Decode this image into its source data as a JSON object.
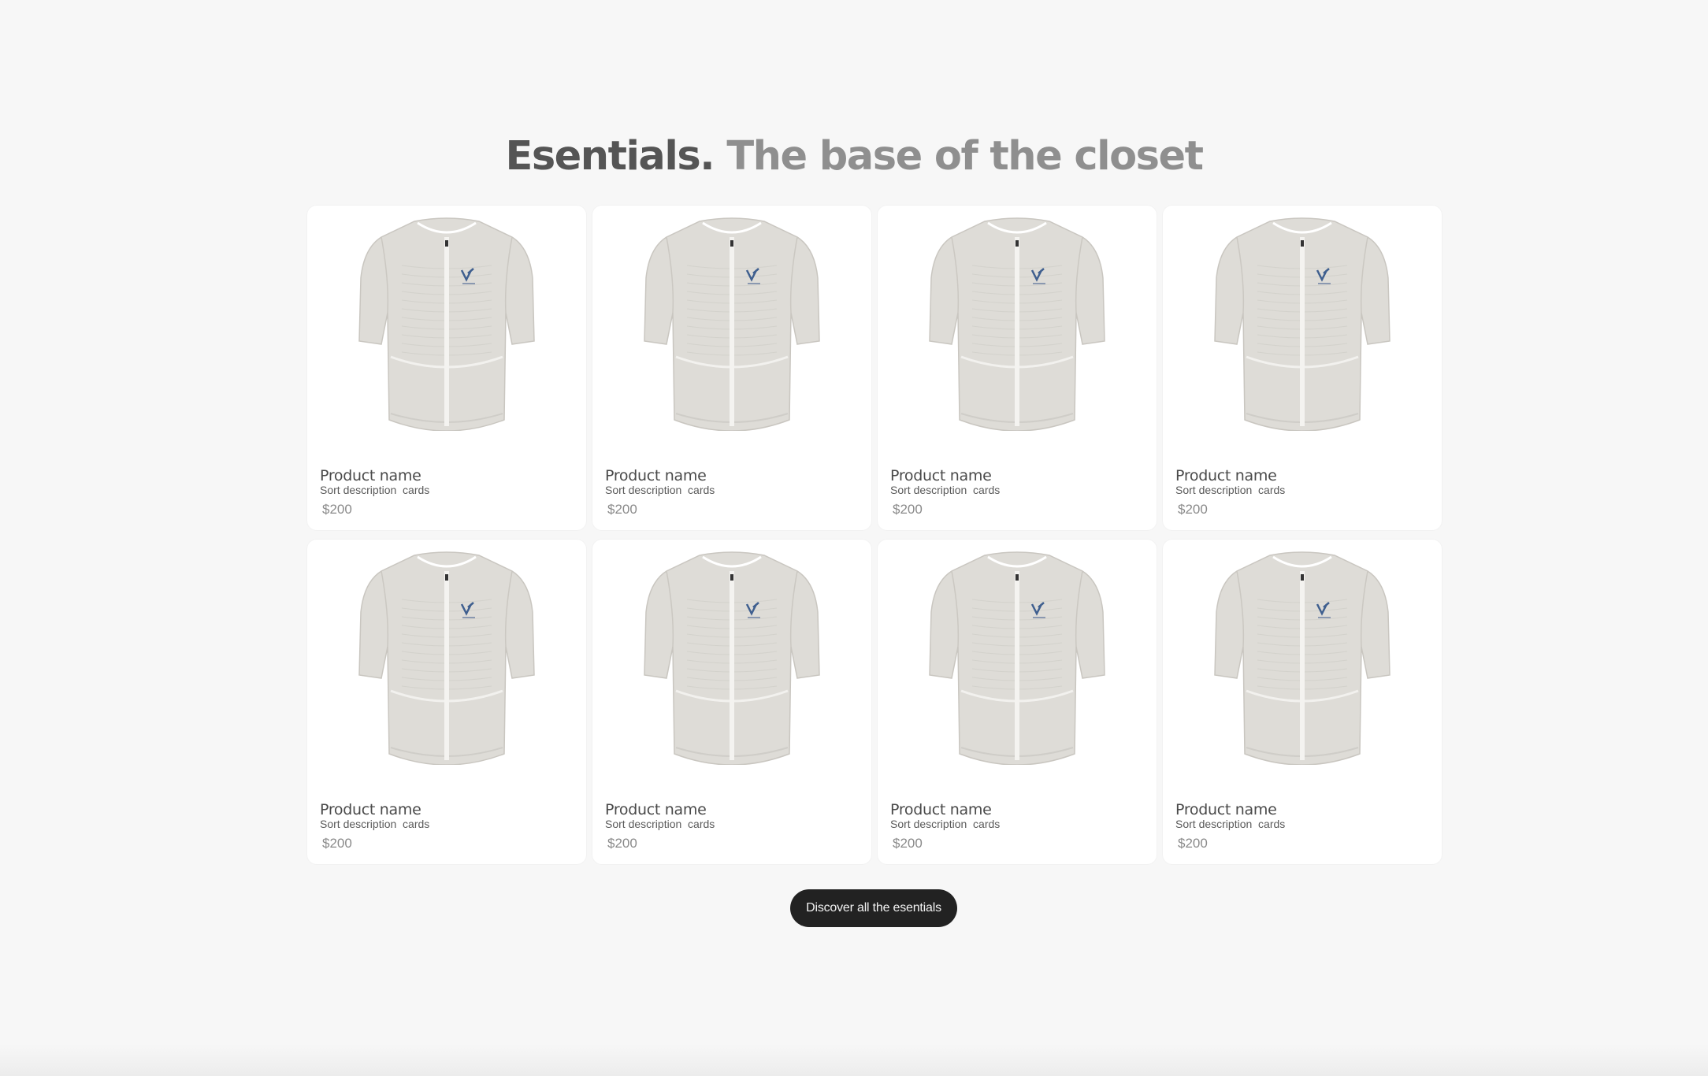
{
  "section": {
    "title_strong": "Esentials.",
    "title_soft": "The base of the closet"
  },
  "products": [
    {
      "name": "Product name",
      "description": "Sort description  cards",
      "price": "$200",
      "image": "cycling-jersey-image"
    },
    {
      "name": "Product name",
      "description": "Sort description  cards",
      "price": "$200",
      "image": "cycling-jersey-image"
    },
    {
      "name": "Product name",
      "description": "Sort description  cards",
      "price": "$200",
      "image": "cycling-jersey-image"
    },
    {
      "name": "Product name",
      "description": "Sort description  cards",
      "price": "$200",
      "image": "cycling-jersey-image"
    },
    {
      "name": "Product name",
      "description": "Sort description  cards",
      "price": "$200",
      "image": "cycling-jersey-image"
    },
    {
      "name": "Product name",
      "description": "Sort description  cards",
      "price": "$200",
      "image": "cycling-jersey-image"
    },
    {
      "name": "Product name",
      "description": "Sort description  cards",
      "price": "$200",
      "image": "cycling-jersey-image"
    },
    {
      "name": "Product name",
      "description": "Sort description  cards",
      "price": "$200",
      "image": "cycling-jersey-image"
    }
  ],
  "cta": {
    "label": "Discover all the esentials"
  },
  "colors": {
    "background": "#f7f7f7",
    "card": "#ffffff",
    "jersey": "#dedcd7",
    "logo": "#3f5f8f",
    "button": "#222222"
  }
}
